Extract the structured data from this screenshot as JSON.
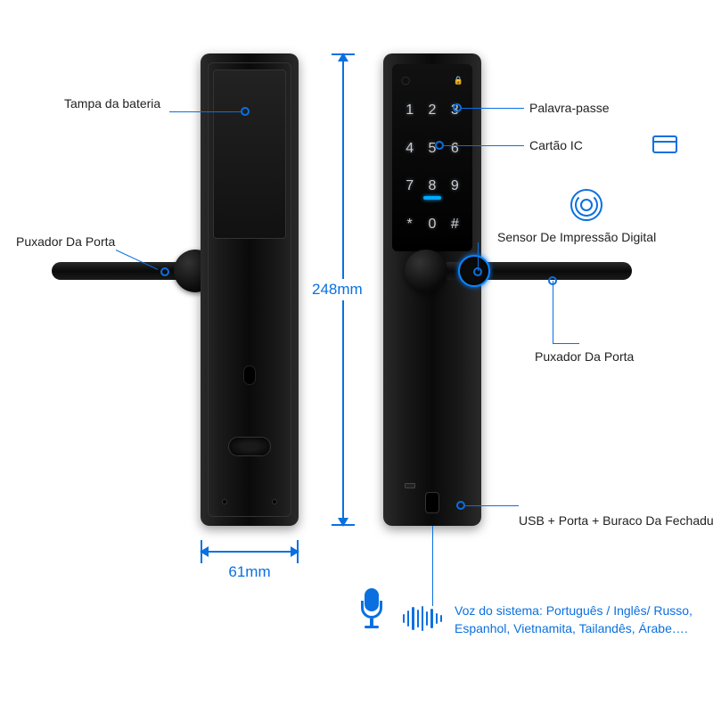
{
  "labels": {
    "battery_cover": "Tampa da bateria",
    "door_handle_left": "Puxador Da Porta",
    "door_handle_right": "Puxador Da Porta",
    "password": "Palavra-passe",
    "ic_card": "Cartão IC",
    "fingerprint_sensor": "Sensor De Impressão Digital",
    "usb_bottom": "USB + Porta + Buraco Da Fechadura",
    "voice_info": "Voz do sistema: Português / Inglês/ Russo, Espanhol, Vietnamita, Tailandês, Árabe…."
  },
  "dimensions": {
    "height": "248mm",
    "width": "61mm"
  },
  "keypad": {
    "keys": [
      "1",
      "2",
      "3",
      "4",
      "5",
      "6",
      "7",
      "8",
      "9",
      "*",
      "0",
      "#"
    ]
  }
}
